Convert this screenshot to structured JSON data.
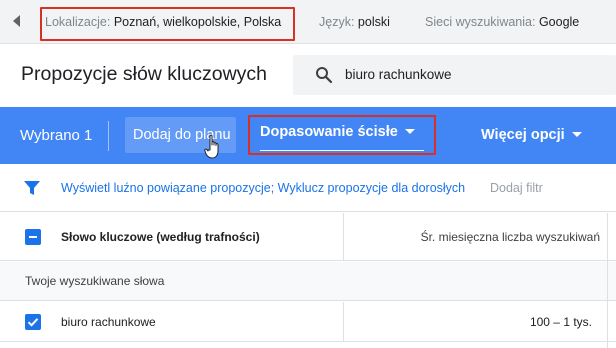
{
  "topbar": {
    "location_label": "Lokalizacje:",
    "location_value": "Poznań, wielkopolskie, Polska",
    "language_label": "Język:",
    "language_value": "polski",
    "network_label": "Sieci wyszukiwania:",
    "network_value": "Google",
    "back_icon": "chevron-left-icon"
  },
  "header": {
    "title": "Propozycje słów kluczowych",
    "search_value": "biuro rachunkowe",
    "search_icon": "search-icon"
  },
  "actionbar": {
    "selected_label": "Wybrano 1",
    "add_to_plan_label": "Dodaj do planu",
    "match_type_label": "Dopasowanie ścisłe",
    "more_options_label": "Więcej opcji",
    "background_color": "#4285f4"
  },
  "filters": {
    "filter_icon": "funnel-icon",
    "active_filters_text": "Wyświetl luźno powiązane propozycje; Wyklucz propozycje dla dorosłych",
    "add_filter_label": "Dodaj filtr"
  },
  "table": {
    "columns": [
      "Słowo kluczowe (według trafności)",
      "Śr. miesięczna liczba wyszukiwań"
    ],
    "group_label": "Twoje wyszukiwane słowa",
    "rows": [
      {
        "keyword": "biuro rachunkowe",
        "monthly_searches": "100 – 1 tys.",
        "checked": true
      }
    ]
  },
  "colors": {
    "accent": "#1a73e8",
    "highlight_box": "#d93025"
  }
}
